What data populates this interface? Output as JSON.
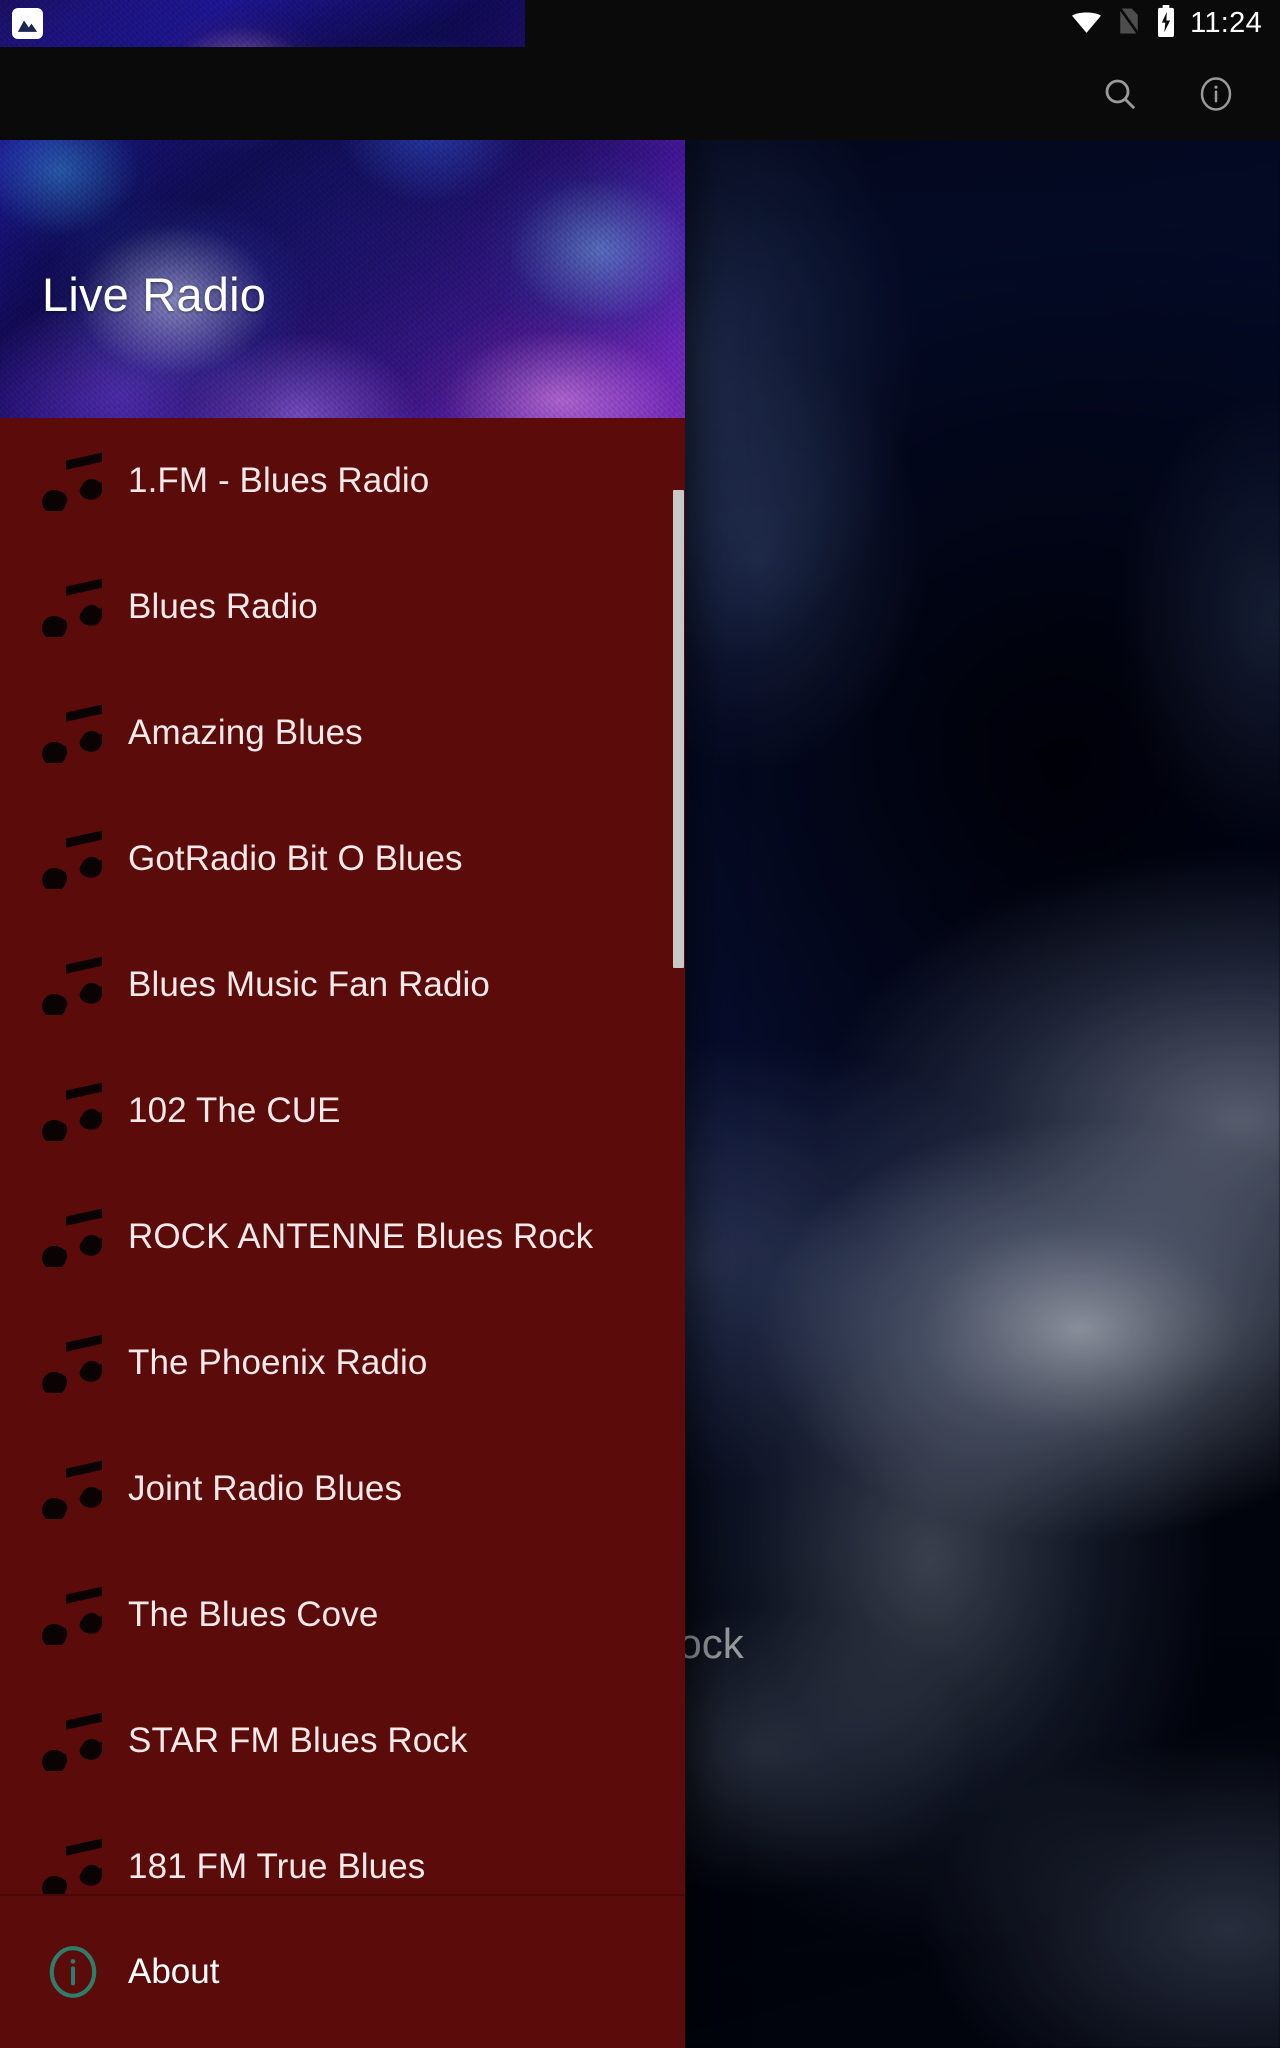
{
  "status_bar": {
    "notification_icon": "photo-image-icon",
    "wifi_icon": "wifi-icon",
    "sim_icon": "no-sim-icon",
    "battery_icon": "battery-charging-icon",
    "time": "11:24"
  },
  "app_bar": {
    "search_icon": "search-icon",
    "info_icon": "info-circle-icon"
  },
  "main_content": {
    "label": "Rock"
  },
  "drawer": {
    "header_title": "Live Radio",
    "background_color": "#5c0b0b",
    "item_icon": "music-note-icon",
    "stations": [
      {
        "label": "1.FM - Blues Radio"
      },
      {
        "label": "Blues Radio"
      },
      {
        "label": "Amazing Blues"
      },
      {
        "label": "GotRadio Bit O Blues"
      },
      {
        "label": "Blues Music Fan Radio"
      },
      {
        "label": "102 The CUE"
      },
      {
        "label": "ROCK ANTENNE Blues Rock"
      },
      {
        "label": "The Phoenix Radio"
      },
      {
        "label": "Joint Radio Blues"
      },
      {
        "label": "The Blues Cove"
      },
      {
        "label": "STAR FM Blues Rock"
      },
      {
        "label": "181 FM True Blues"
      }
    ],
    "footer": {
      "icon": "info-circle-icon",
      "label": "About",
      "icon_color": "#2e7d6b"
    }
  }
}
